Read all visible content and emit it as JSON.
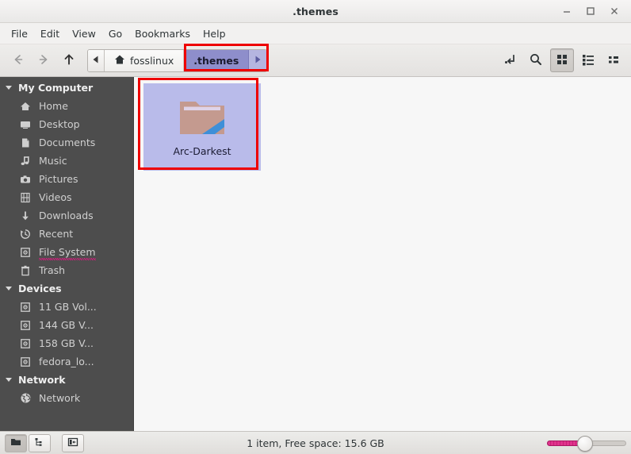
{
  "window": {
    "title": ".themes",
    "controls": {
      "minimize": "minimize",
      "maximize": "maximize",
      "close": "close"
    }
  },
  "menubar": {
    "items": [
      {
        "label": "File"
      },
      {
        "label": "Edit"
      },
      {
        "label": "View"
      },
      {
        "label": "Go"
      },
      {
        "label": "Bookmarks"
      },
      {
        "label": "Help"
      }
    ]
  },
  "toolbar": {
    "back": "back-arrow",
    "forward": "forward-arrow",
    "up": "up-arrow",
    "path_scroll_left": "◀",
    "path_scroll_right": "▶",
    "breadcrumbs": [
      {
        "label": "fosslinux",
        "icon": "home-icon",
        "active": false
      },
      {
        "label": ".themes",
        "icon": "",
        "active": true
      }
    ],
    "buttons": {
      "location_entry": "location-entry-icon",
      "search": "search-icon",
      "icon_view": "icon-view-icon",
      "list_view": "list-view-icon",
      "compact_view": "compact-view-icon"
    }
  },
  "sidebar": {
    "groups": [
      {
        "label": "My Computer",
        "expanded": true,
        "items": [
          {
            "label": "Home",
            "icon": "home-icon"
          },
          {
            "label": "Desktop",
            "icon": "desktop-icon"
          },
          {
            "label": "Documents",
            "icon": "document-icon"
          },
          {
            "label": "Music",
            "icon": "music-note-icon"
          },
          {
            "label": "Pictures",
            "icon": "camera-icon"
          },
          {
            "label": "Videos",
            "icon": "film-icon"
          },
          {
            "label": "Downloads",
            "icon": "download-arrow-icon"
          },
          {
            "label": "Recent",
            "icon": "clock-history-icon"
          },
          {
            "label": "File System",
            "icon": "drive-icon",
            "spellcheck": true
          },
          {
            "label": "Trash",
            "icon": "trash-icon"
          }
        ]
      },
      {
        "label": "Devices",
        "expanded": true,
        "items": [
          {
            "label": "11 GB Vol...",
            "icon": "drive-icon"
          },
          {
            "label": "144 GB V...",
            "icon": "drive-icon"
          },
          {
            "label": "158 GB V...",
            "icon": "drive-icon"
          },
          {
            "label": "fedora_lo...",
            "icon": "drive-icon"
          }
        ]
      },
      {
        "label": "Network",
        "expanded": true,
        "items": [
          {
            "label": "Network",
            "icon": "globe-icon"
          }
        ]
      }
    ]
  },
  "files": [
    {
      "name": "Arc-Darkest",
      "icon": "folder-icon",
      "selected": true
    }
  ],
  "statusbar": {
    "text": "1 item, Free space: 15.6 GB",
    "buttons": {
      "places": "places-icon",
      "tree": "tree-icon",
      "toggle_sidebar": "sidebar-toggle-icon"
    },
    "zoom": {
      "value": 48,
      "label": "zoom-slider"
    }
  },
  "colors": {
    "sidebar_bg": "#4d4d4d",
    "selection": "#b9bbea",
    "accent_crumb": "#8e8ecb",
    "annotation": "#ee0000",
    "slider_fill": "#e0338c",
    "folder": "#c49a8f",
    "folder_stripe": "#3e8fd8"
  }
}
